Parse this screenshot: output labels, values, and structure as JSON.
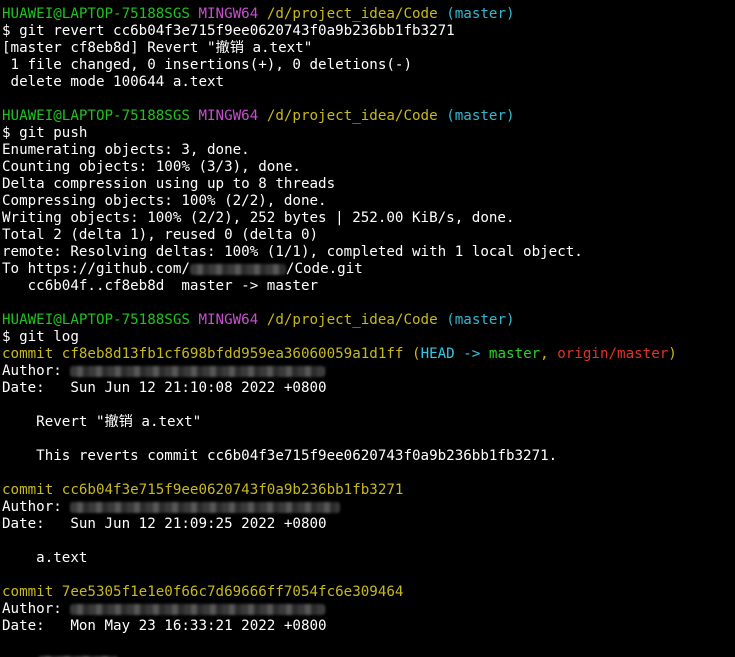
{
  "prompt": {
    "user_host": "HUAWEI@LAPTOP-75188SGS",
    "system": "MINGW64",
    "path": "/d/project_idea/Code",
    "branch": "(master)",
    "symbol": "$ "
  },
  "block1": {
    "command": "git revert cc6b04f3e715f9ee0620743f0a9b236bb1fb3271",
    "output": [
      "[master cf8eb8d] Revert \"撤销 a.text\"",
      " 1 file changed, 0 insertions(+), 0 deletions(-)",
      " delete mode 100644 a.text"
    ]
  },
  "block2": {
    "command": "git push",
    "output": [
      "Enumerating objects: 3, done.",
      "Counting objects: 100% (3/3), done.",
      "Delta compression using up to 8 threads",
      "Compressing objects: 100% (2/2), done.",
      "Writing objects: 100% (2/2), 252 bytes | 252.00 KiB/s, done.",
      "Total 2 (delta 1), reused 0 (delta 0)",
      "remote: Resolving deltas: 100% (1/1), completed with 1 local object."
    ],
    "to_prefix": "To https://github.com/",
    "to_suffix": "/Code.git",
    "update_line": "   cc6b04f..cf8eb8d  master -> master"
  },
  "block3": {
    "command": "git log",
    "commits": [
      {
        "commit_line": "commit cf8eb8d13fb1cf698bfdd959ea36060059a1d1ff",
        "refs": {
          "open": " (",
          "head": "HEAD -> ",
          "branch": "master",
          "sep": ", ",
          "origin": "origin/master",
          "close": ")"
        },
        "author_label": "Author: ",
        "date_line": "Date:   Sun Jun 12 21:10:08 2022 +0800",
        "message": [
          "    Revert \"撤销 a.text\"",
          "    This reverts commit cc6b04f3e715f9ee0620743f0a9b236bb1fb3271."
        ]
      },
      {
        "commit_line": "commit cc6b04f3e715f9ee0620743f0a9b236bb1fb3271",
        "author_label": "Author: ",
        "date_line": "Date:   Sun Jun 12 21:09:25 2022 +0800",
        "message": [
          "    a.text"
        ]
      },
      {
        "commit_line": "commit 7ee5305f1e1e0f66c7d69666ff7054fc6e309464",
        "author_label": "Author: ",
        "date_line": "Date:   Mon May 23 16:33:21 2022 +0800"
      }
    ]
  },
  "colors": {
    "background": "#000000",
    "prompt_user": "#1ec31e",
    "prompt_system": "#c94ed2",
    "prompt_path": "#c8b91c",
    "prompt_branch": "#34b7d1",
    "commit_hash": "#c8b91c",
    "head_ref": "#33c9e8",
    "local_branch": "#26d426",
    "remote_branch": "#e2322a"
  }
}
